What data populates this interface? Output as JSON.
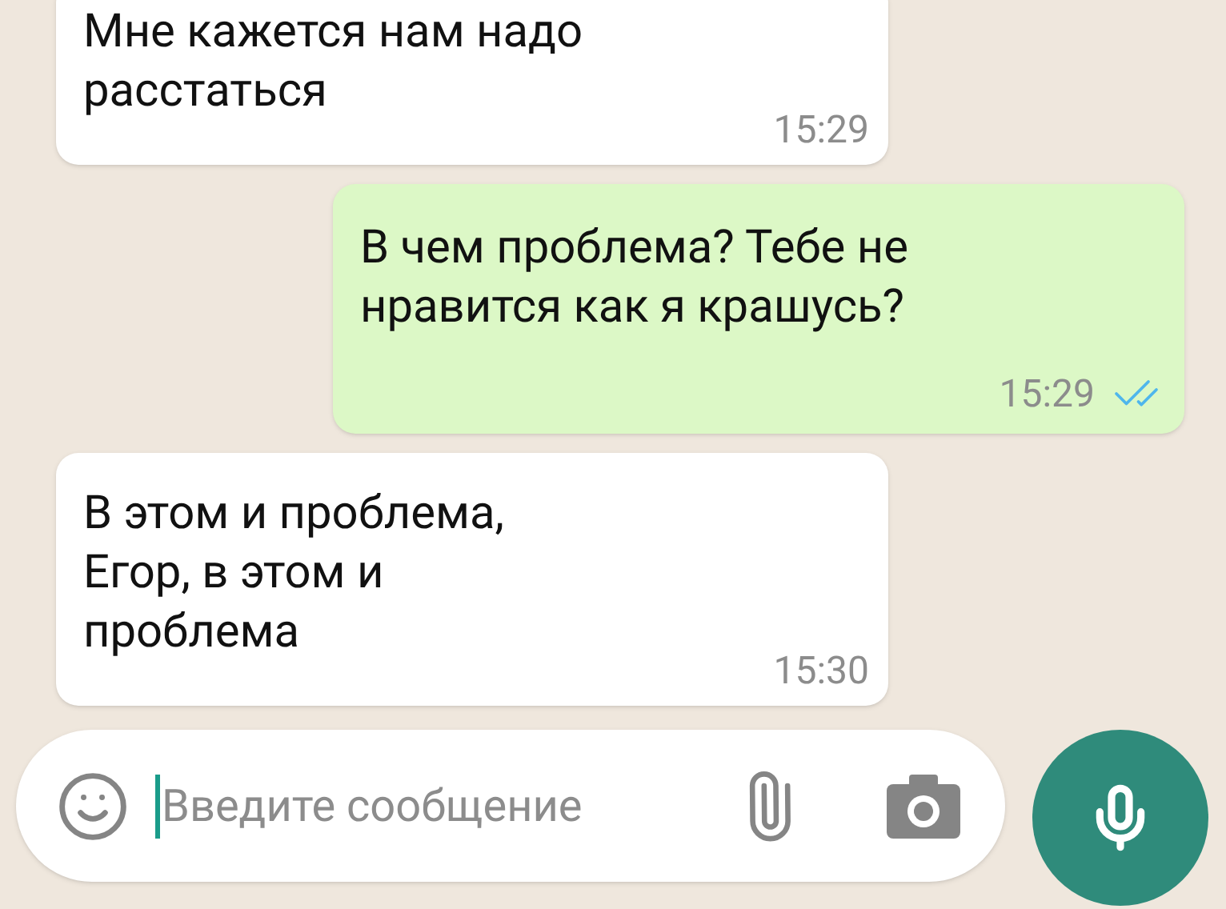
{
  "messages": [
    {
      "kind": "incoming",
      "lines": [
        "Мне кажется нам надо",
        "расстаться"
      ],
      "time": "15:29"
    },
    {
      "kind": "outgoing",
      "lines": [
        "В чем проблема? Тебе не",
        "нравится как я крашусь?"
      ],
      "time": "15:29",
      "read": true
    },
    {
      "kind": "incoming",
      "lines": [
        "В этом и проблема,",
        "Егор, в этом и",
        "проблема"
      ],
      "time": "15:30"
    }
  ],
  "composer": {
    "placeholder": "Введите сообщение"
  }
}
